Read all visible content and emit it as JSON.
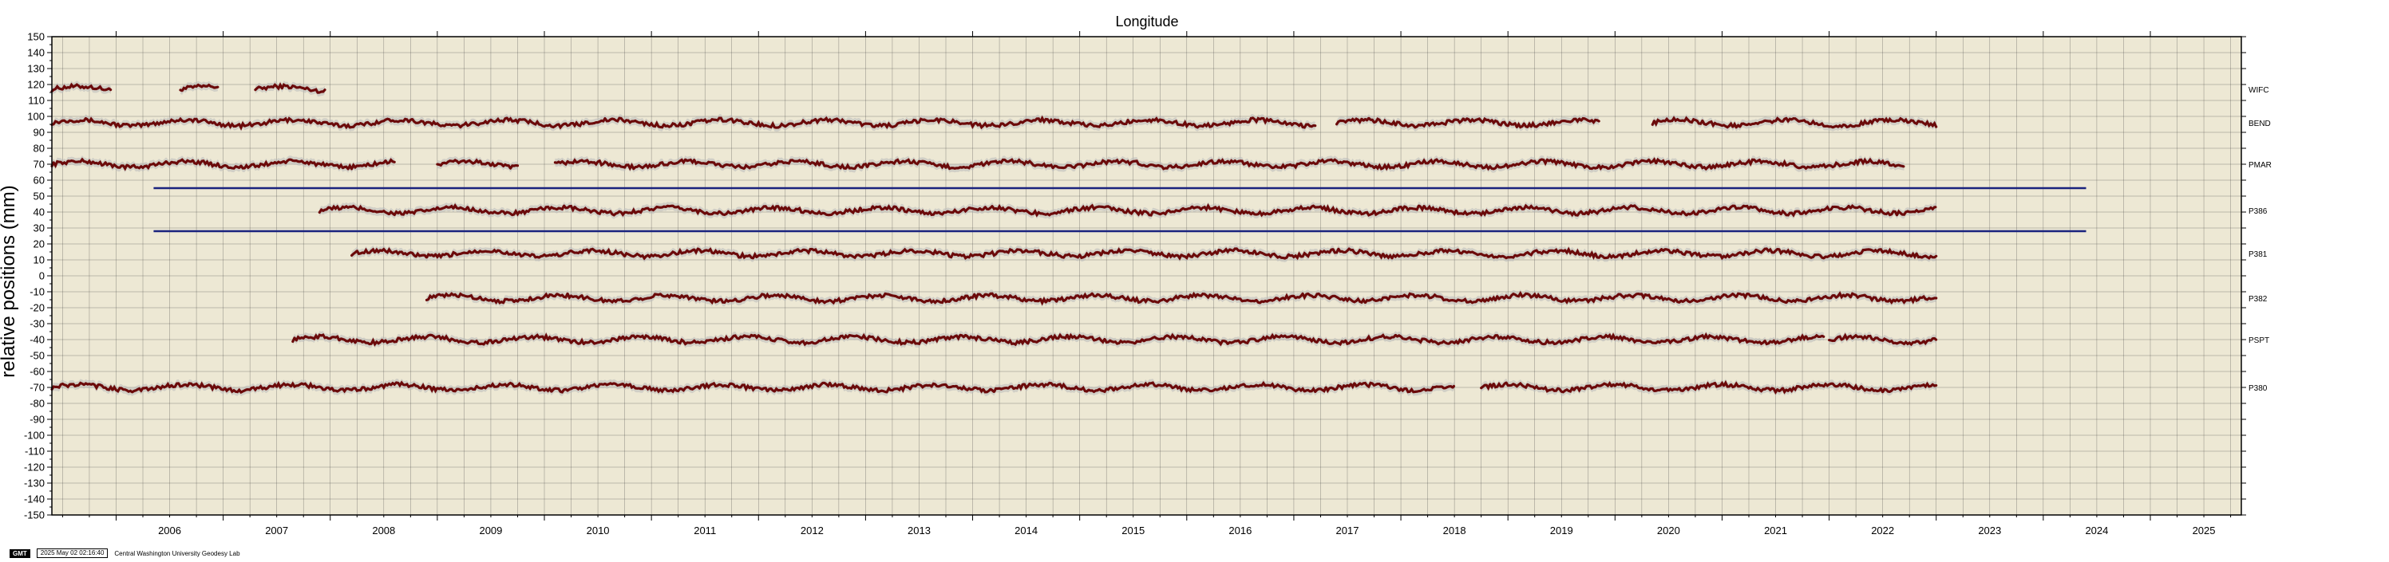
{
  "chart_data": {
    "type": "scatter",
    "title": "Longitude",
    "ylabel": "relative positions (mm)",
    "xlabel": "",
    "xlim": [
      2005.4,
      2025.85
    ],
    "ylim": [
      -150,
      150
    ],
    "yticks": [
      150,
      140,
      130,
      120,
      110,
      100,
      90,
      80,
      70,
      60,
      50,
      40,
      30,
      20,
      10,
      0,
      -10,
      -20,
      -30,
      -40,
      -50,
      -60,
      -70,
      -80,
      -90,
      -100,
      -110,
      -120,
      -130,
      -140,
      -150
    ],
    "xtick_labels": [
      "2006",
      "2007",
      "2008",
      "2009",
      "2010",
      "2011",
      "2012",
      "2013",
      "2014",
      "2015",
      "2016",
      "2017",
      "2018",
      "2019",
      "2020",
      "2021",
      "2022",
      "2023",
      "2024",
      "2025"
    ],
    "grid": true,
    "colors": {
      "plot_bg": "#ede8d4",
      "points": "#6b0a0a",
      "uncertainty": "#b9b9b9",
      "reference_line": "#1a237e",
      "grid": "#3c3c3c"
    },
    "reference_lines": [
      {
        "y": 55,
        "x_start": 2006.35,
        "x_end": 2024.4
      },
      {
        "y": 28,
        "x_start": 2006.35,
        "x_end": 2024.4
      }
    ],
    "series": [
      {
        "name": "WIFC",
        "offset": 117,
        "segments": [
          [
            2005.4,
            2005.95
          ],
          [
            2006.6,
            2006.95
          ],
          [
            2007.3,
            2007.95
          ]
        ]
      },
      {
        "name": "BEND",
        "offset": 96,
        "segments": [
          [
            2005.4,
            2017.2
          ],
          [
            2017.4,
            2019.85
          ],
          [
            2020.35,
            2023.0
          ]
        ]
      },
      {
        "name": "PMAR",
        "offset": 70,
        "segments": [
          [
            2005.4,
            2008.6
          ],
          [
            2009.0,
            2009.75
          ],
          [
            2010.1,
            2022.7
          ]
        ]
      },
      {
        "name": "P386",
        "offset": 41,
        "segments": [
          [
            2007.9,
            2023.0
          ]
        ]
      },
      {
        "name": "P381",
        "offset": 14,
        "segments": [
          [
            2008.2,
            2023.0
          ]
        ]
      },
      {
        "name": "P382",
        "offset": -14,
        "segments": [
          [
            2008.9,
            2023.0
          ]
        ]
      },
      {
        "name": "PSPT",
        "offset": -40,
        "segments": [
          [
            2007.65,
            2021.95
          ],
          [
            2022.0,
            2023.0
          ]
        ]
      },
      {
        "name": "P380",
        "offset": -70,
        "segments": [
          [
            2005.4,
            2018.5
          ],
          [
            2018.75,
            2023.0
          ]
        ]
      }
    ]
  },
  "footer": {
    "logo": "GMT",
    "timestamp": "2025 May 02 02:16:40",
    "credit": "Central Washington University Geodesy Lab"
  }
}
